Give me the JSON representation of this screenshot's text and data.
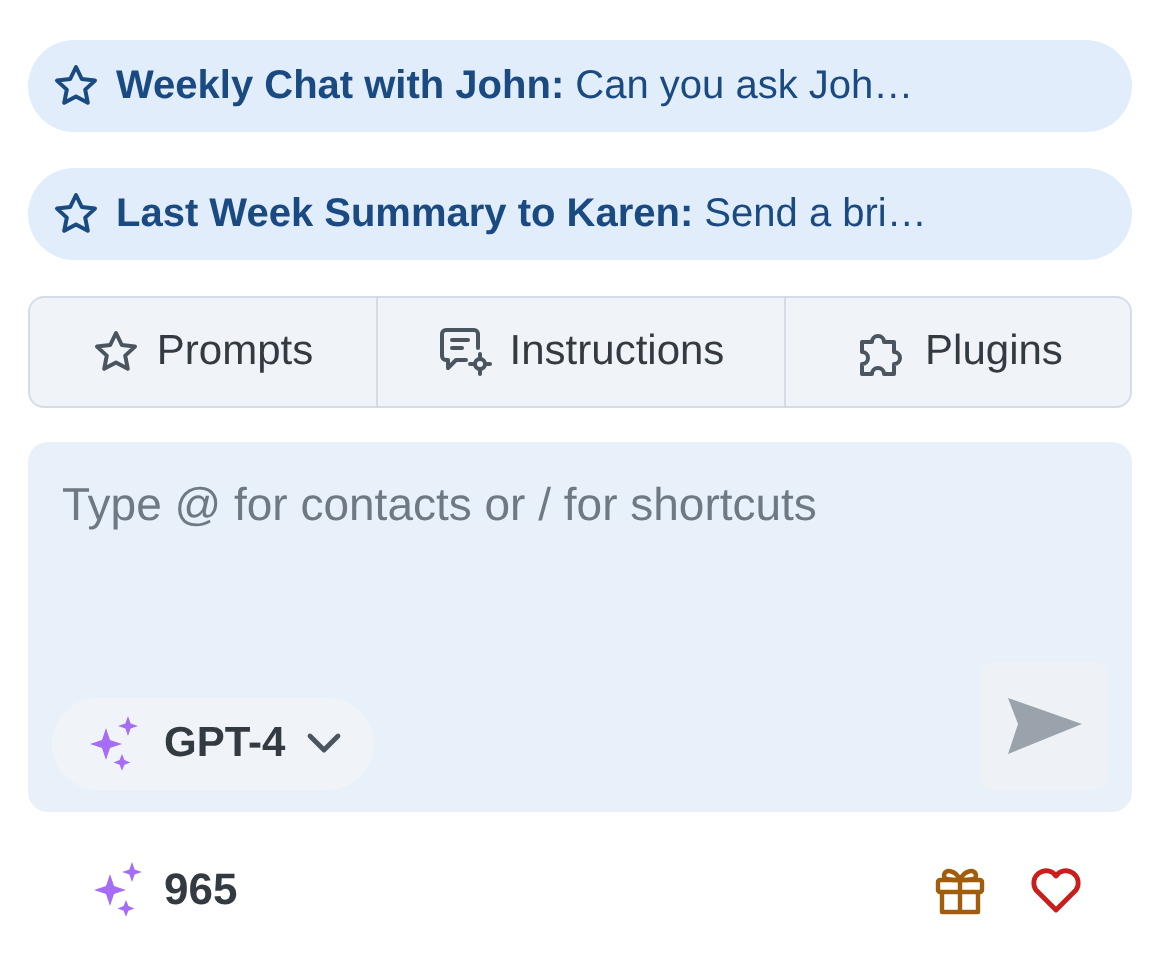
{
  "suggestions": [
    {
      "text": "**Weekly Chat with John:** Can you ask Joh…"
    },
    {
      "text": "**Last Week Summary to Karen:** Send a bri…"
    }
  ],
  "tabs": [
    {
      "label": "Prompts"
    },
    {
      "label": "Instructions"
    },
    {
      "label": "Plugins"
    }
  ],
  "composer": {
    "placeholder": "Type @ for contacts or / for shortcuts",
    "model": "GPT-4",
    "send_disabled": true
  },
  "footer": {
    "credits": "965"
  }
}
